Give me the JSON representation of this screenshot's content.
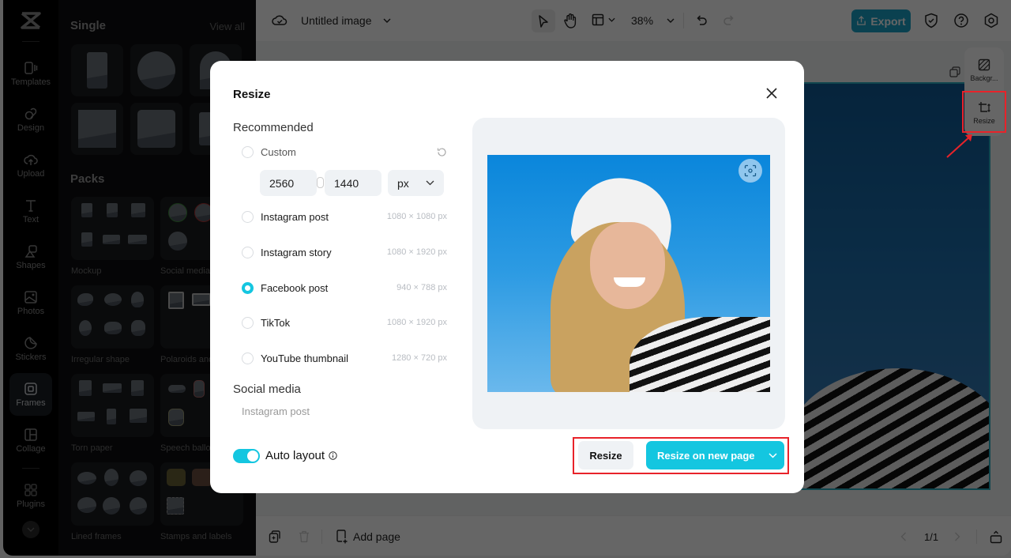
{
  "app": {
    "rail": {
      "items": [
        {
          "label": "Templates",
          "icon": "templates-icon"
        },
        {
          "label": "Design",
          "icon": "design-icon"
        },
        {
          "label": "Upload",
          "icon": "upload-icon"
        },
        {
          "label": "Text",
          "icon": "text-icon"
        },
        {
          "label": "Shapes",
          "icon": "shapes-icon"
        },
        {
          "label": "Photos",
          "icon": "photos-icon"
        },
        {
          "label": "Stickers",
          "icon": "stickers-icon"
        },
        {
          "label": "Frames",
          "icon": "frames-icon",
          "active": true
        },
        {
          "label": "Collage",
          "icon": "collage-icon"
        },
        {
          "label": "Plugins",
          "icon": "plugins-icon"
        }
      ]
    },
    "panel": {
      "single_title": "Single",
      "view_all": "View all",
      "packs_title": "Packs",
      "packs": [
        "Mockup",
        "Social media",
        "Irregular shape",
        "Polaroids and",
        "Torn paper",
        "Speech ballo",
        "Lined frames",
        "Stamps and labels"
      ]
    },
    "topbar": {
      "doc_title": "Untitled image",
      "zoom": "38%",
      "export_label": "Export"
    },
    "right_tools": [
      {
        "label": "Backgr...",
        "icon": "background-icon"
      },
      {
        "label": "Resize",
        "icon": "resize-icon"
      }
    ],
    "bottombar": {
      "add_page": "Add page",
      "page_indicator": "1/1"
    }
  },
  "dialog": {
    "title": "Resize",
    "recommended_title": "Recommended",
    "custom": {
      "label": "Custom",
      "width": "2560",
      "height": "1440",
      "unit": "px"
    },
    "presets": [
      {
        "label": "Instagram post",
        "size": "1080 × 1080 px",
        "selected": false
      },
      {
        "label": "Instagram story",
        "size": "1080 × 1920 px",
        "selected": false
      },
      {
        "label": "Facebook post",
        "size": "940 × 788 px",
        "selected": true
      },
      {
        "label": "TikTok",
        "size": "1080 × 1920 px",
        "selected": false
      },
      {
        "label": "YouTube thumbnail",
        "size": "1280 × 720 px",
        "selected": false
      }
    ],
    "social_title": "Social media",
    "social_first": "Instagram post",
    "auto_layout_label": "Auto layout",
    "auto_layout_on": true,
    "resize_label": "Resize",
    "resize_new_label": "Resize on new page"
  },
  "colors": {
    "accent": "#14c6e0",
    "export": "#1aa3c7",
    "annotation": "#e8232a"
  }
}
